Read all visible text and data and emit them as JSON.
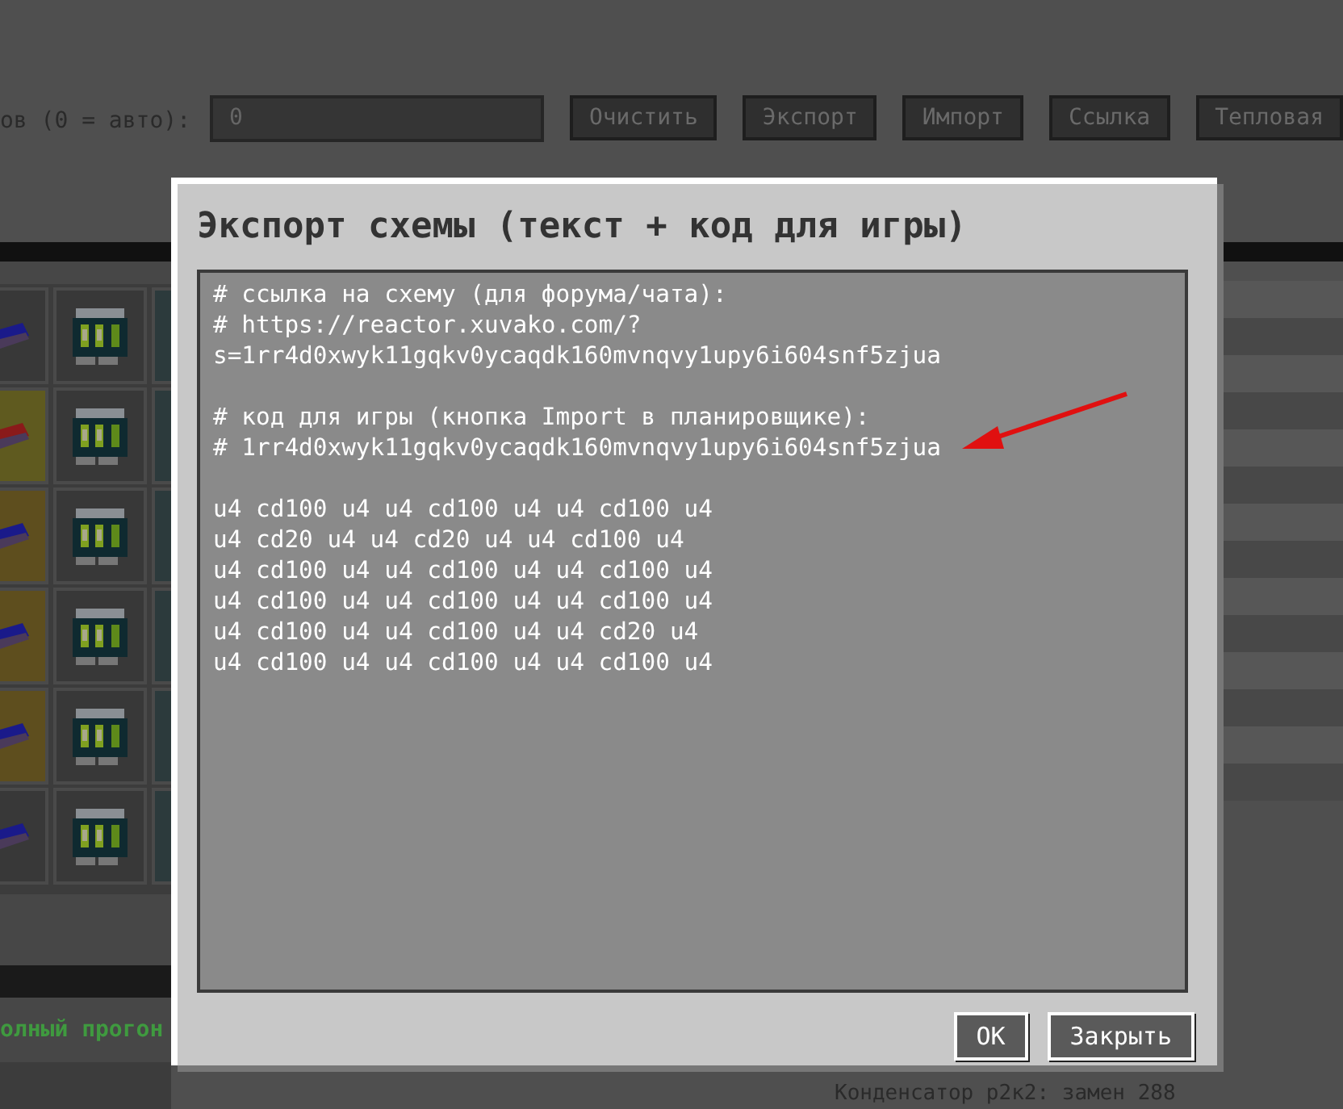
{
  "toolbar": {
    "label": "ов (0 = авто):",
    "input_value": "0",
    "buttons": [
      "Очистить",
      "Экспорт",
      "Импорт",
      "Ссылка",
      "Тепловая"
    ]
  },
  "status_text": "олный прогон",
  "side_text": "Конденсатор р2к2: замен 288",
  "dialog": {
    "title": "Экспорт схемы (текст + код для игры)",
    "blocks": [
      [
        "# ссылка на схему (для форума/чата):",
        "# https://reactor.xuvako.com/?",
        "s=1rr4d0xwyk11gqkv0ycaqdk160mvnqvy1upy6i604snf5zjua"
      ],
      [
        "# код для игры (кнопка Import в планировщике):",
        "# 1rr4d0xwyk11gqkv0ycaqdk160mvnqvy1upy6i604snf5zjua"
      ],
      [
        "u4 cd100 u4 u4 cd100 u4 u4 cd100 u4",
        "u4 cd20 u4 u4 cd20 u4 u4 cd100 u4",
        "u4 cd100 u4 u4 cd100 u4 u4 cd100 u4",
        "u4 cd100 u4 u4 cd100 u4 u4 cd100 u4",
        "u4 cd100 u4 u4 cd100 u4 u4 cd20 u4",
        "u4 cd100 u4 u4 cd100 u4 u4 cd100 u4"
      ]
    ],
    "buttons": [
      "OK",
      "Закрыть"
    ]
  }
}
